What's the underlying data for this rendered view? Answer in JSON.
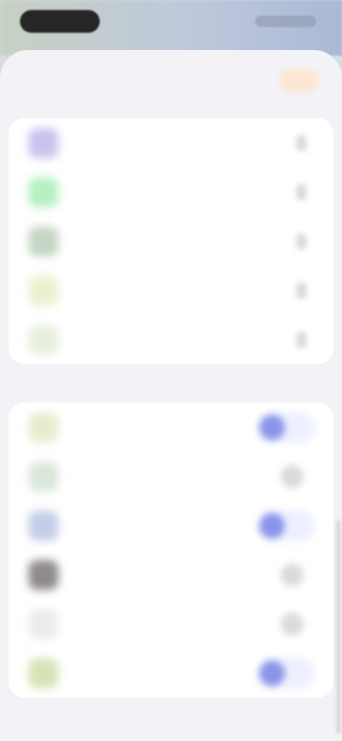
{
  "status_bar": {
    "time": "",
    "icons": ""
  },
  "header": {
    "title": "",
    "action_label": ""
  },
  "group1": {
    "items": [
      {
        "label": "",
        "icon": "purple-app-icon",
        "color": "#c9c3ef"
      },
      {
        "label": "",
        "icon": "green-app-icon",
        "color": "#b6f0c3"
      },
      {
        "label": "",
        "icon": "photo-app-icon",
        "color": "#c6d6c4"
      },
      {
        "label": "",
        "icon": "yellow-app-icon",
        "color": "#edf0cf"
      },
      {
        "label": "",
        "icon": "light-app-icon",
        "color": "#e9efe0"
      }
    ]
  },
  "group2": {
    "section_label": "",
    "items": [
      {
        "label": "",
        "icon": "olive-app-icon",
        "color": "#e9ebcf",
        "toggle": "on"
      },
      {
        "label": "",
        "icon": "sage-app-icon",
        "color": "#dbe7db",
        "toggle": "off"
      },
      {
        "label": "",
        "icon": "blue-app-icon",
        "color": "#c4cde6",
        "toggle": "on"
      },
      {
        "label": "",
        "icon": "dark-app-icon",
        "color": "#8f8a8d",
        "toggle": "off"
      },
      {
        "label": "",
        "icon": "pale-app-icon",
        "color": "#ececec",
        "toggle": "off"
      },
      {
        "label": "",
        "icon": "lime-app-icon",
        "color": "#d7e3b6",
        "toggle": "on"
      }
    ]
  }
}
